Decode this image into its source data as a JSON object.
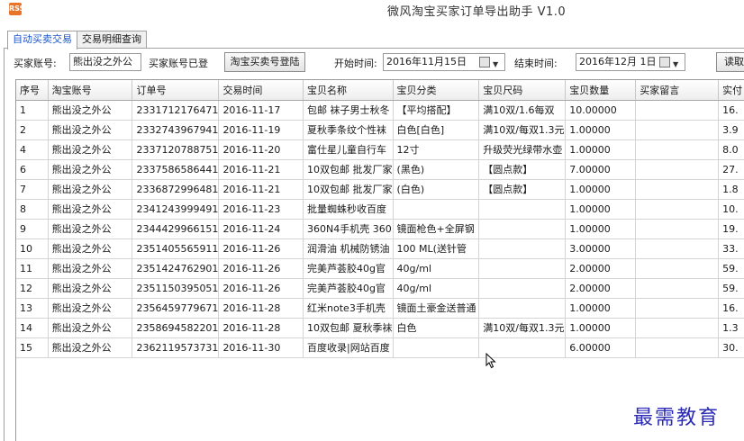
{
  "window": {
    "title": "微风淘宝买家订单导出助手 V1.0",
    "icon": "app-logo-icon"
  },
  "tabs": [
    {
      "label": "自动买卖交易",
      "active": true
    },
    {
      "label": "交易明细查询",
      "active": false
    }
  ],
  "toolbar": {
    "account_label": "买家账号:",
    "account_value": "熊出没之外公",
    "account_status": "买家账号已登",
    "login_button": "淘宝买卖号登陆",
    "start_label": "开始时间:",
    "start_value": "2016年11月15日",
    "end_label": "结束时间:",
    "end_value": "2016年12月 1日",
    "read_button": "读取"
  },
  "table": {
    "columns": [
      "序号",
      "淘宝账号",
      "订单号",
      "交易时间",
      "宝贝名称",
      "宝贝分类",
      "宝贝尺码",
      "宝贝数量",
      "买家留言",
      "实付"
    ],
    "rows": [
      [
        "1",
        "熊出没之外公",
        "2331712176471",
        "2016-11-17",
        "包邮 袜子男士秋冬",
        "【平均搭配】",
        "满10双/1.6每双",
        "10.00000",
        "",
        "16."
      ],
      [
        "2",
        "熊出没之外公",
        "2332743967941",
        "2016-11-19",
        "夏秋季条纹个性袜",
        "白色[白色]",
        "满10双/每双1.3元",
        "1.00000",
        "",
        "3.9"
      ],
      [
        "4",
        "熊出没之外公",
        "2337120788751",
        "2016-11-20",
        "富仕星儿童自行车",
        "12寸",
        "升级荧光绿带水壶",
        "1.00000",
        "",
        "8.0"
      ],
      [
        "6",
        "熊出没之外公",
        "2337586586441",
        "2016-11-21",
        "10双包邮 批发厂家",
        "(黑色)",
        "【圆点款】",
        "7.00000",
        "",
        "27."
      ],
      [
        "7",
        "熊出没之外公",
        "2336872996481",
        "2016-11-21",
        "10双包邮 批发厂家",
        "(白色)",
        "【圆点款】",
        "1.00000",
        "",
        "1.8"
      ],
      [
        "8",
        "熊出没之外公",
        "2341243999491",
        "2016-11-23",
        "批量蜘蛛秒收百度",
        "",
        "",
        "1.00000",
        "",
        "10."
      ],
      [
        "9",
        "熊出没之外公",
        "2344429966151",
        "2016-11-24",
        "360N4手机壳 360",
        "镜面枪色+全屏钢",
        "",
        "1.00000",
        "",
        "19."
      ],
      [
        "10",
        "熊出没之外公",
        "2351405565911",
        "2016-11-26",
        "润滑油 机械防锈油",
        "100 ML(送针管",
        "",
        "3.00000",
        "",
        "33."
      ],
      [
        "11",
        "熊出没之外公",
        "2351424762901",
        "2016-11-26",
        "完美芦荟胶40g官",
        "40g/ml",
        "",
        "2.00000",
        "",
        "59."
      ],
      [
        "12",
        "熊出没之外公",
        "2351150395051",
        "2016-11-26",
        "完美芦荟胶40g官",
        "40g/ml",
        "",
        "2.00000",
        "",
        "59."
      ],
      [
        "13",
        "熊出没之外公",
        "2356459779671",
        "2016-11-28",
        "红米note3手机壳",
        "镜面土豪金送普通",
        "",
        "1.00000",
        "",
        "16."
      ],
      [
        "14",
        "熊出没之外公",
        "2358694582201",
        "2016-11-28",
        "10双包邮 夏秋季袜",
        "白色",
        "满10双/每双1.3元",
        "1.00000",
        "",
        "1.3"
      ],
      [
        "15",
        "熊出没之外公",
        "2362119573731",
        "2016-11-30",
        "百度收录|网站百度",
        "",
        "",
        "6.00000",
        "",
        "30."
      ]
    ]
  },
  "watermark": "最需教育",
  "colors": {
    "active_tab_text": "#1a55c8",
    "app_icon": "#e8742a",
    "watermark": "#2b2bb5"
  }
}
